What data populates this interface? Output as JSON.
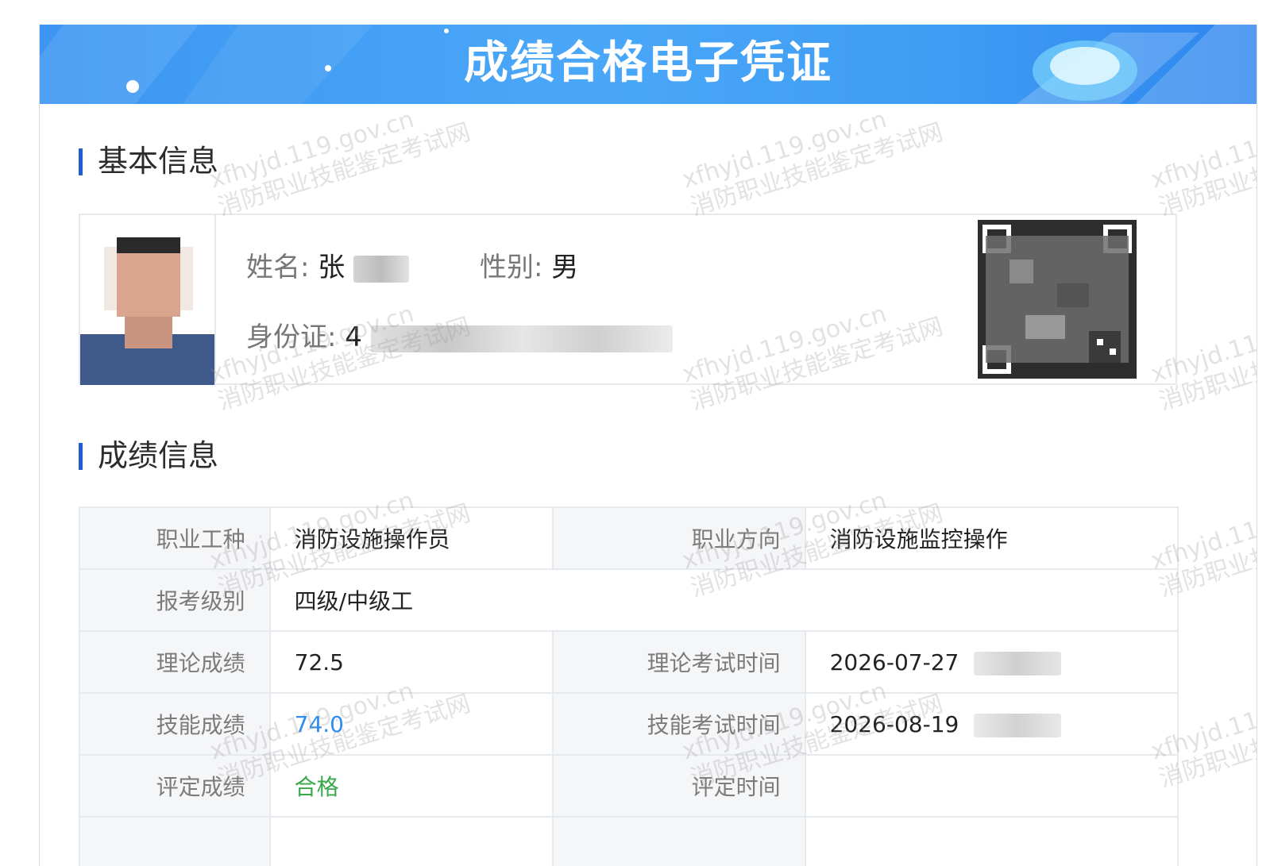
{
  "header": {
    "title": "成绩合格电子凭证"
  },
  "basic": {
    "section_title": "基本信息",
    "name_label": "姓名:",
    "name_value": "张",
    "gender_label": "性别:",
    "gender_value": "男",
    "id_label": "身份证:",
    "id_value": "4"
  },
  "scores": {
    "section_title": "成绩信息",
    "rows": [
      {
        "k1": "职业工种",
        "v1": "消防设施操作员",
        "k2": "职业方向",
        "v2": "消防设施监控操作"
      },
      {
        "k1": "报考级别",
        "v1": "四级/中级工"
      },
      {
        "k1": "理论成绩",
        "v1": "72.5",
        "k2": "理论考试时间",
        "v2": "2026-07-27"
      },
      {
        "k1": "技能成绩",
        "v1": "74.0",
        "k2": "技能考试时间",
        "v2": "2026-08-19"
      },
      {
        "k1": "评定成绩",
        "v1": "合格",
        "k2": "评定时间",
        "v2": ""
      }
    ]
  },
  "watermark": {
    "line1": "xfhyjd.119.gov.cn",
    "line2": "消防职业技能鉴定考试网"
  },
  "colors": {
    "accent": "#1f5fd6",
    "banner": "#3c96f2",
    "link": "#2f8cf0",
    "pass": "#3aa84a"
  }
}
